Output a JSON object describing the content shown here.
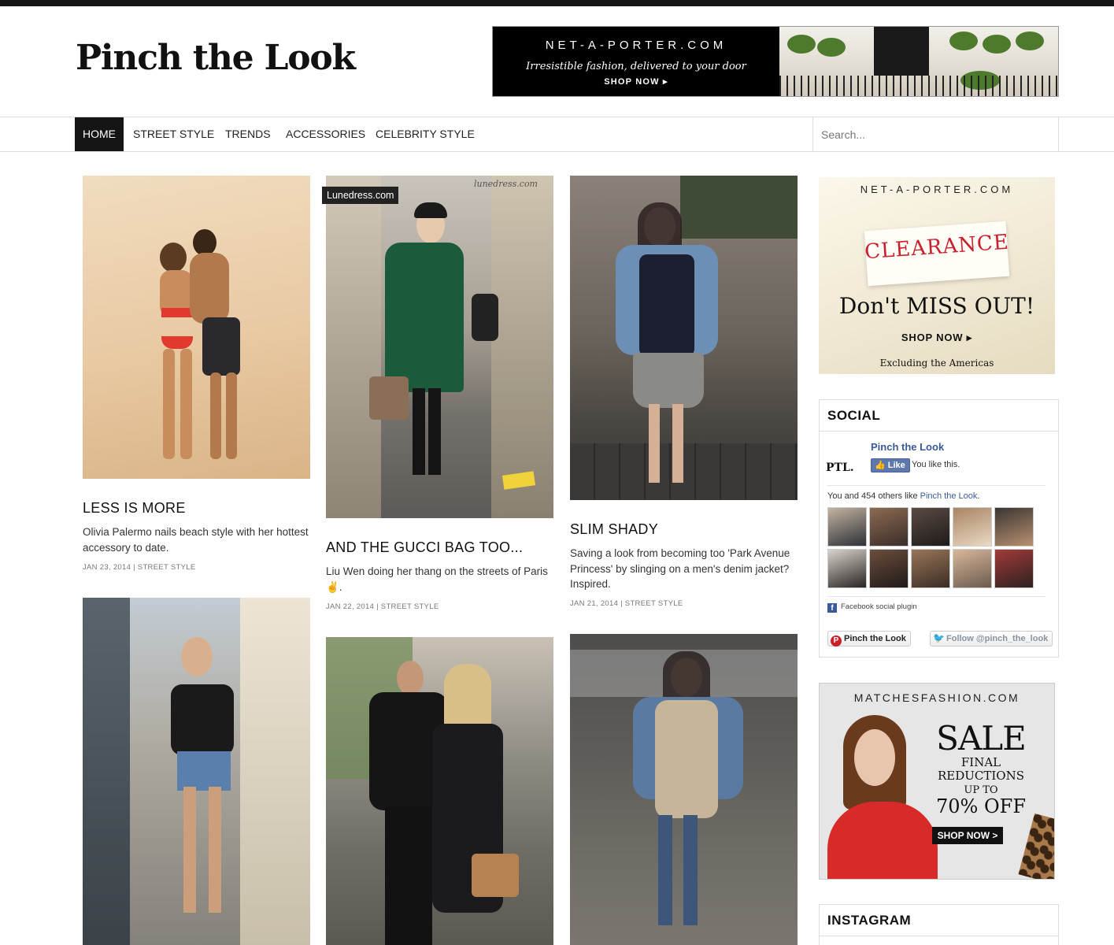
{
  "site": {
    "logo": "Pinch the Look"
  },
  "header_ad": {
    "brand": "NET-A-PORTER.COM",
    "tagline": "Irresistible fashion, delivered to your door",
    "cta": "SHOP NOW ▸"
  },
  "nav": {
    "items": [
      {
        "label": "HOME",
        "active": true
      },
      {
        "label": "STREET STYLE",
        "active": false
      },
      {
        "label": "TRENDS",
        "active": false
      },
      {
        "label": "ACCESSORIES",
        "active": false
      },
      {
        "label": "CELEBRITY STYLE",
        "active": false
      }
    ],
    "search_placeholder": "Search..."
  },
  "posts": [
    {
      "title": "LESS IS MORE",
      "excerpt": "Olivia Palermo nails beach style with her hottest accessory to date.",
      "meta": "JAN 23, 2014 | STREET STYLE"
    },
    {
      "credit": "Lunedress.com",
      "watermark": "lunedress.com",
      "title": "AND THE GUCCI BAG TOO...",
      "excerpt": "Liu Wen doing her thang on the streets of Paris ✌.",
      "meta": "JAN 22, 2014 | STREET STYLE"
    },
    {
      "title": "SLIM SHADY",
      "excerpt": "Saving a look from becoming too 'Park Avenue Princess' by slinging on a men's denim jacket? Inspired.",
      "meta": "JAN 21, 2014 | STREET STYLE"
    }
  ],
  "sidebar": {
    "ad1": {
      "brand": "NET-A-PORTER.COM",
      "label": "CLEARANCE",
      "headline": "Don't MISS OUT!",
      "cta": "SHOP NOW ▸",
      "note": "Excluding the Americas"
    },
    "social": {
      "title": "SOCIAL",
      "fb_logo": "PTL.",
      "fb_page": "Pinch the Look",
      "like_label": "Like",
      "you_like": "You like this.",
      "count_prefix": "You and 454 others like ",
      "count_link": "Pinch the Look",
      "count_suffix": ".",
      "plugin_label": "Facebook social plugin",
      "pinterest_label": "Pinch the Look",
      "twitter_label": "Follow @pinch_the_look"
    },
    "ad2": {
      "brand": "MATCHESFASHION.COM",
      "headline": "SALE",
      "line1": "FINAL",
      "line2": "REDUCTIONS",
      "upto": "UP TO",
      "offer": "70% OFF",
      "cta": "SHOP NOW >"
    },
    "instagram": {
      "title": "INSTAGRAM"
    }
  },
  "colors": {
    "topbar": "#151515",
    "nav_active_bg": "#151515",
    "fb_blue": "#3b5998",
    "clearance_red": "#c8202c"
  }
}
